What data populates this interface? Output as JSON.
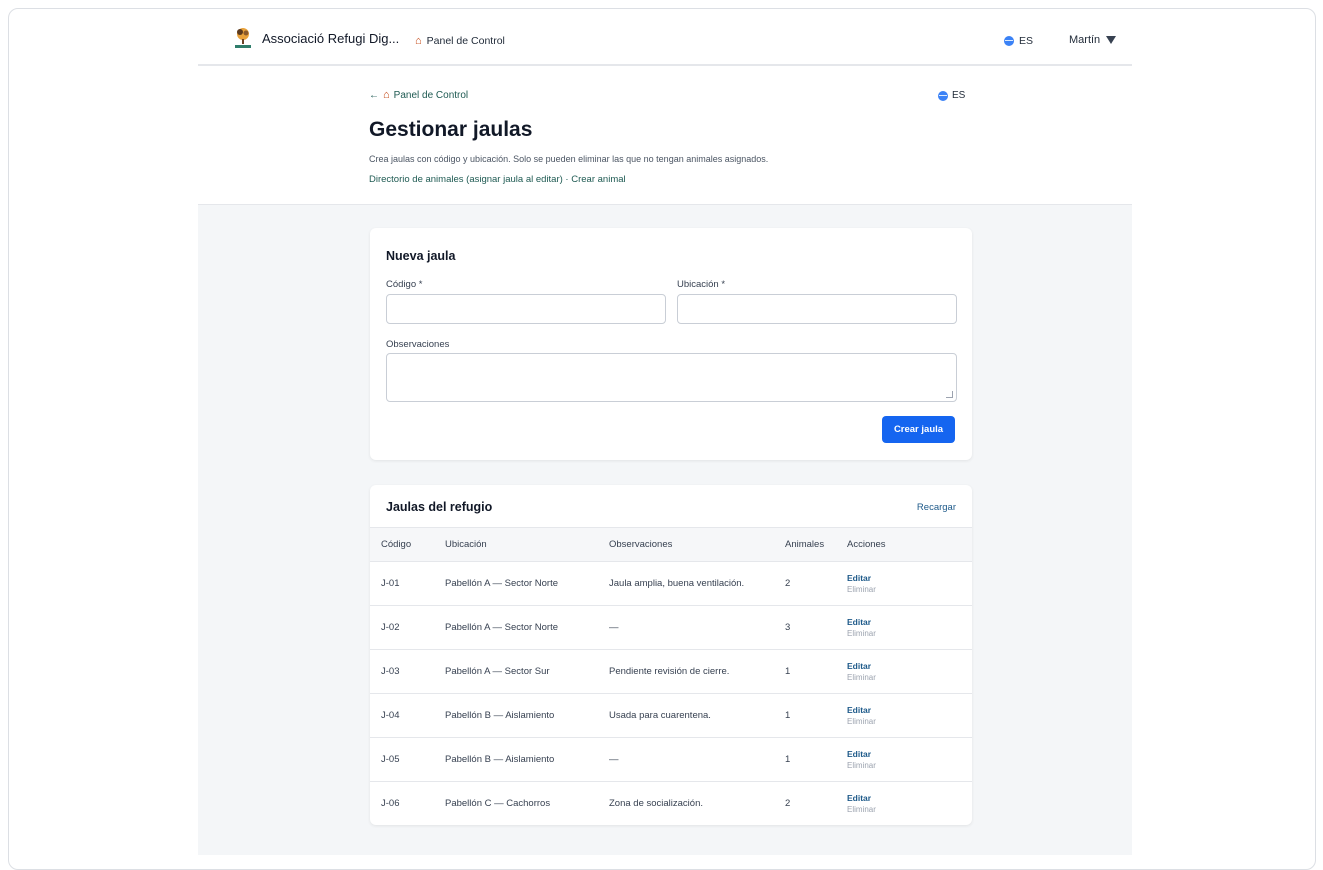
{
  "navbar": {
    "brand_name": "Associació Refugi Dig...",
    "panel_link": "Panel de Control",
    "lang": "ES",
    "user": "Martín"
  },
  "header": {
    "back_link": "← ",
    "back_label": "Panel de Control",
    "lang": "ES",
    "title": "Gestionar jaulas",
    "description": "Crea jaulas con código y ubicación. Solo se pueden eliminar las que no tengan animales asignados.",
    "link_directory": "Directorio de animales (asignar jaula al editar)",
    "link_separator": " · ",
    "link_create": "Crear animal"
  },
  "form": {
    "title": "Nueva jaula",
    "code_label": "Código *",
    "code_value": "",
    "location_label": "Ubicación *",
    "location_value": "",
    "notes_label": "Observaciones",
    "notes_value": "",
    "submit_label": "Crear jaula"
  },
  "table": {
    "title": "Jaulas del refugio",
    "reload_label": "Recargar",
    "columns": [
      "Código",
      "Ubicación",
      "Observaciones",
      "Animales",
      "Acciones"
    ],
    "edit_label": "Editar",
    "delete_label": "Eliminar",
    "rows": [
      {
        "code": "J-01",
        "location": "Pabellón A — Sector Norte",
        "notes": "Jaula amplia, buena ventilación.",
        "animals": "2"
      },
      {
        "code": "J-02",
        "location": "Pabellón A — Sector Norte",
        "notes": "—",
        "animals": "3"
      },
      {
        "code": "J-03",
        "location": "Pabellón A — Sector Sur",
        "notes": "Pendiente revisión de cierre.",
        "animals": "1"
      },
      {
        "code": "J-04",
        "location": "Pabellón B — Aislamiento",
        "notes": "Usada para cuarentena.",
        "animals": "1"
      },
      {
        "code": "J-05",
        "location": "Pabellón B — Aislamiento",
        "notes": "—",
        "animals": "1"
      },
      {
        "code": "J-06",
        "location": "Pabellón C — Cachorros",
        "notes": "Zona de socialización.",
        "animals": "2"
      }
    ]
  },
  "colors": {
    "primary": "#1565f0",
    "link": "#1e5a52",
    "background": "#f4f6f8"
  }
}
